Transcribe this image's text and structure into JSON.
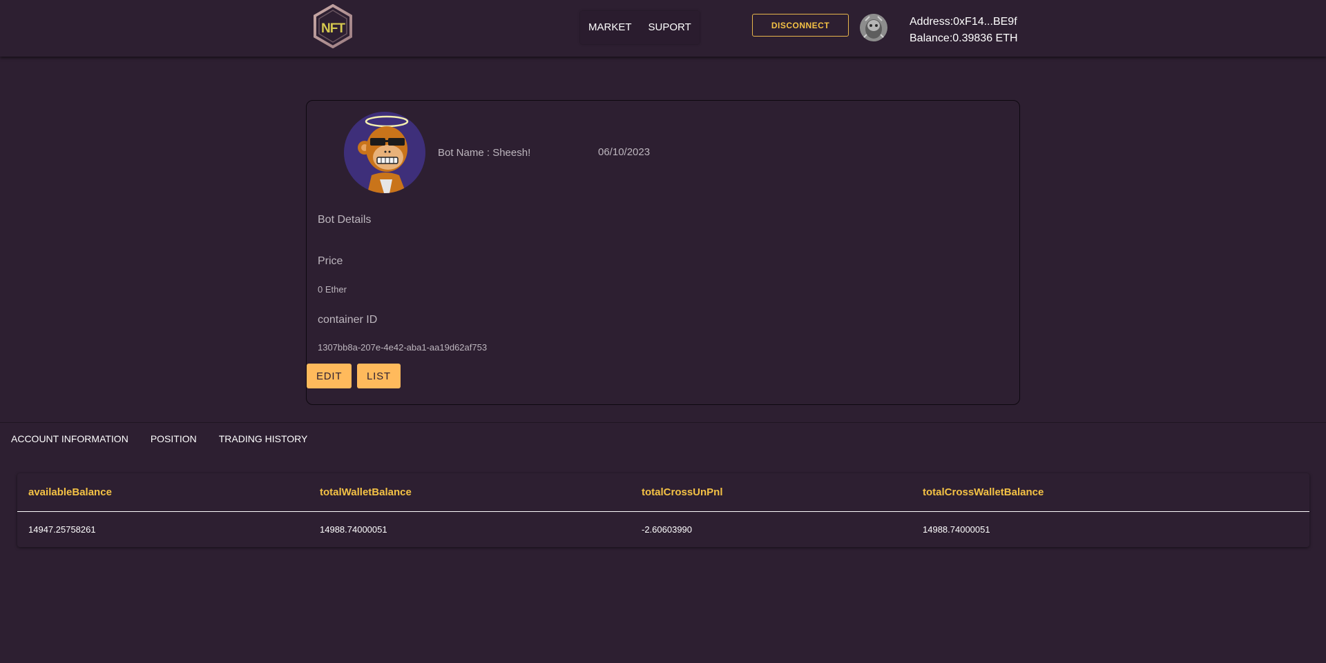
{
  "header": {
    "logo_text": "NFT",
    "nav": [
      {
        "label": "MARKET"
      },
      {
        "label": "SUPORT"
      }
    ],
    "disconnect_label": "DISCONNECT",
    "address_label": "Address:",
    "address": "0xF14...BE9f",
    "balance_label": "Balance:",
    "balance": "0.39836 ETH"
  },
  "bot": {
    "name_label": "Bot Name : Sheesh!",
    "date": "06/10/2023",
    "details_heading": "Bot Details",
    "price_label": "Price",
    "price_value": "0 Ether",
    "container_label": "container ID",
    "container_value": "1307bb8a-207e-4e42-aba1-aa19d62af753",
    "edit_label": "EDIT",
    "list_label": "LIST"
  },
  "tabs": [
    {
      "label": "ACCOUNT INFORMATION"
    },
    {
      "label": "POSITION"
    },
    {
      "label": "TRADING HISTORY"
    }
  ],
  "account_table": {
    "columns": [
      "availableBalance",
      "totalWalletBalance",
      "totalCrossUnPnl",
      "totalCrossWalletBalance"
    ],
    "rows": [
      [
        "14947.25758261",
        "14988.74000051",
        "-2.60603990",
        "14988.74000051"
      ]
    ]
  },
  "colors": {
    "background": "#2d1f31",
    "accent_yellow": "#f4c245",
    "button_orange": "#ffba5c",
    "muted_text": "#bdb6be"
  },
  "icons": {
    "logo": "nft-hexagon-logo",
    "wallet_avatar": "avatar-icon",
    "bot_image": "bored-ape-avatar"
  }
}
